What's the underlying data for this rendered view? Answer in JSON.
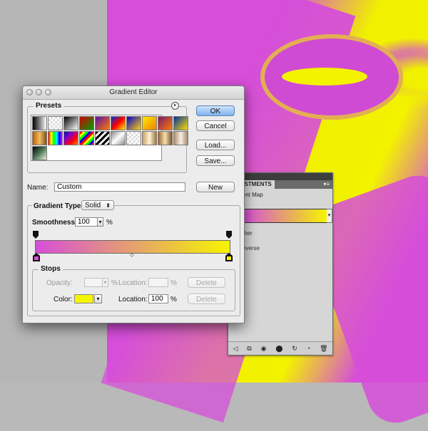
{
  "window": {
    "title": "Gradient Editor"
  },
  "presets": {
    "label": "Presets",
    "swatches": [
      "linear-gradient(90deg,#000,#fff)",
      "repeating-conic-gradient(#ddd 0 25%,#fff 0 50%) 0 0/6px 6px",
      "linear-gradient(135deg,#000 0%,#fff 100%)",
      "linear-gradient(135deg,#d00000,#00a000)",
      "linear-gradient(135deg,#5c0ea8,#ff7b00)",
      "linear-gradient(135deg,#0033cc,#ff0000,#ffee00)",
      "linear-gradient(135deg,#0000d0,#ffd200)",
      "linear-gradient(135deg,#ffea00,#f08000)",
      "linear-gradient(135deg,#7a1b6e,#ff7a00)",
      "linear-gradient(135deg,#0031a0,#ffdd00)",
      "linear-gradient(90deg,#c05a00,#f0c060,#805020)",
      "linear-gradient(90deg,#ff0000,#ffff00,#00ff00,#00ffff,#0000ff,#ff00ff)",
      "linear-gradient(135deg,#0014a8,#8800cc,#ff0000,#ff8800)",
      "repeating-linear-gradient(135deg,#ff0000 0 3px,#ffff00 3px 6px,#00ff00 6px 9px,#0000ff 9px 12px)",
      "repeating-linear-gradient(135deg,#000 0 3px,#fff 3px 6px)",
      "linear-gradient(135deg,#888,#fff,#888)",
      "repeating-conic-gradient(#ddd 0 25%,#fff 0 50%) 0 0/6px 6px",
      "linear-gradient(90deg,#c8a062,#fff4d8,#a07840)",
      "linear-gradient(90deg,#9a6a30,#f6dfb0,#7a5428)",
      "linear-gradient(90deg,#b08e6a,#f5efe7,#a8876a)",
      "linear-gradient(135deg,#000,#4c7a5a,#f0f0dc)"
    ]
  },
  "buttons": {
    "ok": "OK",
    "cancel": "Cancel",
    "load": "Load...",
    "save": "Save...",
    "new": "New",
    "delete_top": "Delete",
    "delete_bottom": "Delete"
  },
  "name": {
    "label": "Name:",
    "value": "Custom"
  },
  "gradient_type": {
    "label": "Gradient Type:",
    "value": "Solid"
  },
  "smoothness": {
    "label": "Smoothness:",
    "value": "100",
    "unit": "%"
  },
  "gradient": {
    "start_color": "#d64ed9",
    "end_color": "#f5f500",
    "midpoint_percent": 50
  },
  "stops": {
    "label": "Stops",
    "opacity_label": "Opacity:",
    "opacity_value": "",
    "opacity_unit": "%",
    "opacity_location_label": "Location:",
    "opacity_location_value": "",
    "opacity_location_unit": "%",
    "color_label": "Color:",
    "color_value": "#f5f500",
    "color_location_label": "Location:",
    "color_location_value": "100",
    "color_location_unit": "%"
  },
  "adjustments": {
    "tab": "JSTMENTS",
    "menu": "▾≡",
    "header": "ient Map",
    "option1": "ther",
    "option2": "everse",
    "footer_icons": [
      "◁",
      "⧉",
      "◉",
      "⬤",
      "↻",
      "◔",
      "🗑"
    ]
  }
}
